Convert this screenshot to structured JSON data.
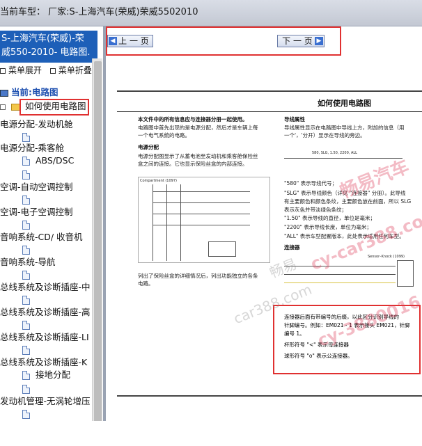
{
  "header": {
    "title": "当前车型：  厂家:S-上海汽车(荣威)荣威5502010"
  },
  "sidebar": {
    "heading_line1": "S-上海汽车(荣威)-荣",
    "heading_line2": "威550-2010- 电路图.",
    "expand_label": "菜单展开",
    "collapse_label": "菜单折叠",
    "current_label": "当前:电路图",
    "selected_item": "如何使用电路图",
    "items": [
      "电源分配-发动机舱",
      "电源分配-乘客舱",
      "ABS/DSC",
      "空调-自动空调控制",
      "空调-电子空调控制",
      "音响系统-CD/ 收音机",
      "音响系统-导航",
      "总线系统及诊断插座-中",
      "总线系统及诊断插座-高",
      "总线系统及诊断插座-LI",
      "总线系统及诊断插座-K",
      "接地分配",
      "发动机管理-无涡轮增压"
    ]
  },
  "toolbar": {
    "prev_label": "上 一 页",
    "next_label": "下 一 页"
  },
  "document": {
    "title": "如何使用电路图",
    "intro_bold": "本文件中的所有信息应与连接器分册一起使用。",
    "intro_1": "电路图中首先出现的是电源分配，然后才是车辆上每",
    "intro_2": "一个电气系统的电路。",
    "section_power": "电源分配",
    "power_1": "电源分配图显示了从蓄电池至发动机和乘客舱保险丝",
    "power_2": "盒之间的连接。它也显示保险丝盒的内部连接。",
    "bottom_1": "列出了保险丝盒的详细情况后，列出功能独立的各条",
    "bottom_2": "电路。",
    "section_wire": "导线属性",
    "wire_1": "导线属性显示在电路图中导线上方，附加的信息（用",
    "wire_2": "一个'，'分开）显示在导线的旁边。",
    "wire_sample": "580, SLG, 1.50, 2200, ALL",
    "attr_1": "\"580\" 表示导线代号；",
    "attr_2": "\"SLG\" 表示导线颜色（详见 \"连接器\" 分册）。此导线",
    "attr_3": "有主要颜色和颜色条纹，主要颜色放在前面，所以 SLG",
    "attr_4": "表示灰色并带淡绿色条纹；",
    "attr_5": "\"1.50\" 表示导线的直径，单位是毫米；",
    "attr_6": "\"2200\" 表示导线长度，单位为毫米；",
    "attr_7": "\"ALL\" 表示车型配置版本，此处表示适用任何车型。",
    "section_conn": "连接器",
    "conn_label": "Sensor–Knock (1099)",
    "conn_1": "连接器后面有带编号的后缀，以此区分识别导线的",
    "conn_2": "针脚编号。例如：EM021 - 1 表示接头 EM021，针脚",
    "conn_3": "编号 1。",
    "conn_4": "杯形符号 \"<\" 表示母连接器",
    "conn_5": "球形符号 \"o\" 表示公连接器。",
    "diagram_label": "Compartment (1097)"
  },
  "watermarks": {
    "w1": "畅易汽车",
    "w2": "cy-car388.com",
    "w3": "畅易",
    "w4": "car388.com",
    "w5": "cy-3880016"
  }
}
